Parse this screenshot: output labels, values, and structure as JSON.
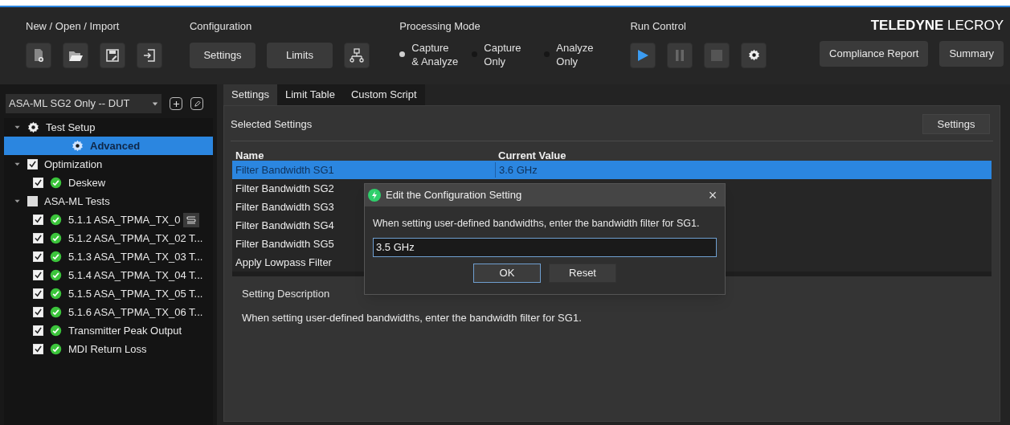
{
  "toolbar": {
    "groups": [
      {
        "label": "New / Open / Import"
      },
      {
        "label": "Configuration"
      },
      {
        "label": "Processing Mode"
      },
      {
        "label": "Run Control"
      }
    ],
    "config_buttons": [
      "Settings",
      "Limits"
    ],
    "processing_modes": [
      {
        "label": "Capture\n& Analyze",
        "selected": true
      },
      {
        "label": "Capture\nOnly",
        "selected": false
      },
      {
        "label": "Analyze\nOnly",
        "selected": false
      }
    ],
    "logo": {
      "bold": "TELEDYNE",
      "light": "LECROY"
    },
    "right_buttons": [
      "Compliance Report",
      "Summary"
    ]
  },
  "sidebar": {
    "config_select": "ASA-ML SG2 Only -- DUT",
    "tree": [
      {
        "kind": "setup",
        "label": "Test Setup",
        "expanded": true,
        "children": [
          {
            "kind": "setup",
            "label": "Advanced",
            "selected": true
          }
        ]
      },
      {
        "kind": "group",
        "label": "Optimization",
        "checked": true,
        "expanded": true,
        "children": [
          {
            "kind": "test",
            "label": "Deskew",
            "checked": true,
            "selected": false
          }
        ]
      },
      {
        "kind": "group",
        "label": "ASA-ML Tests",
        "checked": false,
        "expanded": true,
        "children": [
          {
            "kind": "test",
            "label": "5.1.1 ASA_TPMA_TX_0",
            "checked": true,
            "selected": false,
            "script": true
          },
          {
            "kind": "test",
            "label": "5.1.2 ASA_TPMA_TX_02 T...",
            "checked": true,
            "selected": false
          },
          {
            "kind": "test",
            "label": "5.1.3 ASA_TPMA_TX_03 T...",
            "checked": true,
            "selected": false
          },
          {
            "kind": "test",
            "label": "5.1.4 ASA_TPMA_TX_04 T...",
            "checked": true,
            "selected": false
          },
          {
            "kind": "test",
            "label": "5.1.5 ASA_TPMA_TX_05 T...",
            "checked": true,
            "selected": false
          },
          {
            "kind": "test",
            "label": "5.1.6 ASA_TPMA_TX_06 T...",
            "checked": true,
            "selected": false
          },
          {
            "kind": "test",
            "label": "Transmitter Peak Output",
            "checked": true,
            "selected": false
          },
          {
            "kind": "test",
            "label": "MDI Return Loss",
            "checked": true,
            "selected": false
          }
        ]
      }
    ]
  },
  "tabs": [
    {
      "label": "Settings",
      "selected": true
    },
    {
      "label": "Limit Table",
      "selected": false
    },
    {
      "label": "Custom Script",
      "selected": false
    }
  ],
  "settings": {
    "title": "Selected Settings",
    "button": "Settings",
    "table": {
      "columns": [
        "Name",
        "Current Value"
      ],
      "rows": [
        {
          "name": "Filter Bandwidth SG1",
          "value": "3.6 GHz",
          "selected": true
        },
        {
          "name": "Filter Bandwidth SG2",
          "selected": false
        },
        {
          "name": "Filter Bandwidth SG3",
          "selected": false
        },
        {
          "name": "Filter Bandwidth SG4",
          "selected": false
        },
        {
          "name": "Filter Bandwidth SG5",
          "selected": false
        },
        {
          "name": "Apply Lowpass Filter",
          "selected": false
        }
      ]
    },
    "description_title": "Setting Description",
    "description": "When setting user-defined bandwidths, enter the bandwidth filter for SG1."
  },
  "dialog": {
    "title": "Edit the Configuration Setting",
    "close": "×",
    "prompt": "When setting user-defined bandwidths, enter the bandwidth filter for SG1.",
    "value": "3.5 GHz",
    "buttons": [
      "OK",
      "Reset"
    ]
  }
}
